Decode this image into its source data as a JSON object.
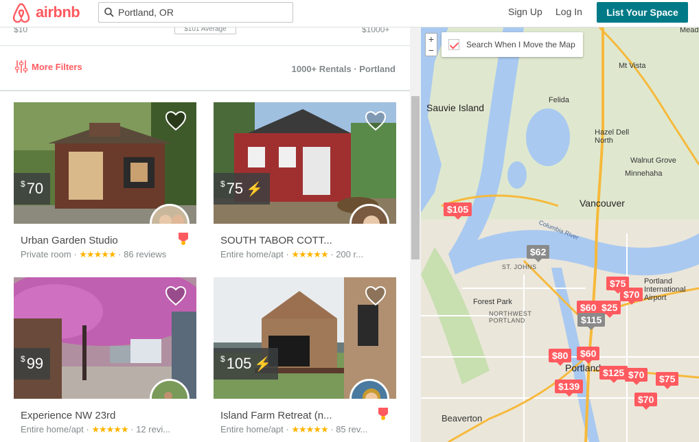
{
  "header": {
    "brand": "airbnb",
    "search_value": "Portland, OR",
    "signup_label": "Sign Up",
    "login_label": "Log In",
    "list_space_label": "List Your Space"
  },
  "price_filter": {
    "min_label": "$10",
    "average_label": "$101 Average",
    "max_label": "$1000+"
  },
  "filters": {
    "more_filters_label": "More Filters",
    "rental_count": "1000+ Rentals · Portland"
  },
  "listings": [
    {
      "price": "70",
      "instant_book": false,
      "title": "Urban Garden Studio",
      "room_type": "Private room",
      "stars": "★★★★★",
      "reviews": "86 reviews",
      "superhost": true
    },
    {
      "price": "75",
      "instant_book": true,
      "title": "SOUTH TABOR COTT...",
      "room_type": "Entire home/apt",
      "stars": "★★★★★",
      "reviews": "200 r...",
      "superhost": false
    },
    {
      "price": "99",
      "instant_book": false,
      "title": "Experience NW 23rd",
      "room_type": "Entire home/apt",
      "stars": "★★★★★",
      "reviews": "12 revi...",
      "superhost": false
    },
    {
      "price": "105",
      "instant_book": true,
      "title": "Island Farm Retreat (n...",
      "room_type": "Entire home/apt",
      "stars": "★★★★★",
      "reviews": "85 rev...",
      "superhost": true
    }
  ],
  "map": {
    "search_when_move_label": "Search When I Move the Map",
    "zoom_in": "+",
    "zoom_out": "−",
    "places": [
      "Sauvie Island",
      "Felida",
      "Mt Vista",
      "Hazel Dell North",
      "Walnut Grove",
      "Minnehaha",
      "Vancouver",
      "Portland International Airport",
      "Forest Park",
      "NORTHWEST PORTLAND",
      "ST. JOHNS",
      "Portland",
      "Beaverton",
      "Columbia River",
      "Meadow"
    ],
    "markers": [
      "$105",
      "$62",
      "$75",
      "$70",
      "$60",
      "$25",
      "$115",
      "$80",
      "$60",
      "$125",
      "$70",
      "$75",
      "$139",
      "$70"
    ]
  },
  "colors": {
    "brand": "#ff5a5f",
    "teal": "#007a87",
    "star": "#ffb400"
  }
}
